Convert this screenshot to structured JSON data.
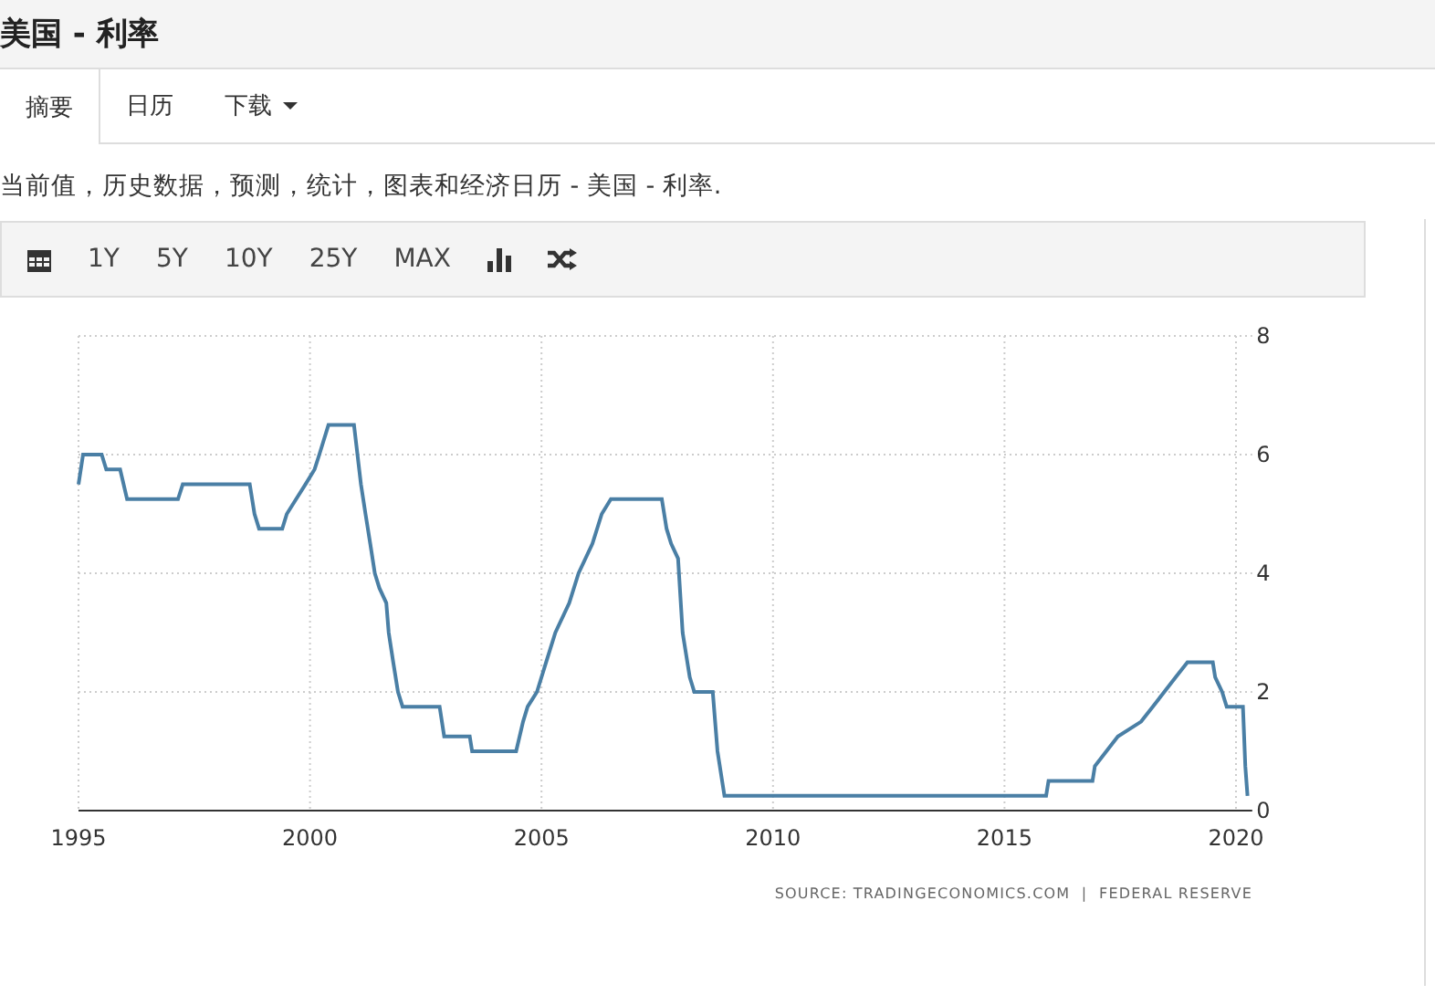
{
  "header": {
    "title": "美国 - 利率"
  },
  "tabs": [
    {
      "label": "摘要",
      "selected": true,
      "dropdown": false
    },
    {
      "label": "日历",
      "selected": false,
      "dropdown": false
    },
    {
      "label": "下载",
      "selected": false,
      "dropdown": true
    }
  ],
  "description": "当前值，历史数据，预测，统计，图表和经济日历 - 美国 - 利率.",
  "toolbar": [
    {
      "kind": "calendar"
    },
    {
      "kind": "text",
      "label": "1Y"
    },
    {
      "kind": "text",
      "label": "5Y"
    },
    {
      "kind": "text",
      "label": "10Y"
    },
    {
      "kind": "text",
      "label": "25Y"
    },
    {
      "kind": "text",
      "label": "MAX"
    },
    {
      "kind": "bars"
    },
    {
      "kind": "shuffle"
    }
  ],
  "chart": {
    "source": "SOURCE: TRADINGECONOMICS.COM  |  FEDERAL RESERVE",
    "chart_data": {
      "type": "line",
      "grid": true,
      "xlim": [
        1995,
        2020.35
      ],
      "ylim": [
        0,
        8
      ],
      "xticks": [
        1995,
        2000,
        2005,
        2010,
        2015,
        2020
      ],
      "yticks": [
        0,
        2,
        4,
        6,
        8
      ],
      "x": [
        1995.0,
        1995.1,
        1995.5,
        1995.6,
        1995.9,
        1996.05,
        1997.15,
        1997.25,
        1998.7,
        1998.8,
        1998.9,
        1999.4,
        1999.5,
        1999.7,
        1999.9,
        2000.1,
        2000.2,
        2000.4,
        2000.95,
        2001.1,
        2001.2,
        2001.3,
        2001.4,
        2001.5,
        2001.65,
        2001.7,
        2001.8,
        2001.9,
        2002.0,
        2002.8,
        2002.9,
        2003.45,
        2003.5,
        2004.45,
        2004.6,
        2004.7,
        2004.9,
        2005.1,
        2005.3,
        2005.6,
        2005.8,
        2006.1,
        2006.3,
        2006.5,
        2007.6,
        2007.7,
        2007.8,
        2007.95,
        2008.05,
        2008.2,
        2008.3,
        2008.7,
        2008.8,
        2008.95,
        2015.9,
        2015.95,
        2016.9,
        2016.95,
        2017.2,
        2017.45,
        2017.95,
        2018.2,
        2018.45,
        2018.7,
        2018.95,
        2019.5,
        2019.55,
        2019.7,
        2019.8,
        2020.15,
        2020.2,
        2020.25
      ],
      "series": [
        {
          "color": "#4a7fa5",
          "values": [
            5.5,
            6.0,
            6.0,
            5.75,
            5.75,
            5.25,
            5.25,
            5.5,
            5.5,
            5.0,
            4.75,
            4.75,
            5.0,
            5.25,
            5.5,
            5.75,
            6.0,
            6.5,
            6.5,
            5.5,
            5.0,
            4.5,
            4.0,
            3.75,
            3.5,
            3.0,
            2.5,
            2.0,
            1.75,
            1.75,
            1.25,
            1.25,
            1.0,
            1.0,
            1.5,
            1.75,
            2.0,
            2.5,
            3.0,
            3.5,
            4.0,
            4.5,
            5.0,
            5.25,
            5.25,
            4.75,
            4.5,
            4.25,
            3.0,
            2.25,
            2.0,
            2.0,
            1.0,
            0.25,
            0.25,
            0.5,
            0.5,
            0.75,
            1.0,
            1.25,
            1.5,
            1.75,
            2.0,
            2.25,
            2.5,
            2.5,
            2.25,
            2.0,
            1.75,
            1.75,
            0.75,
            0.25
          ]
        }
      ]
    }
  }
}
